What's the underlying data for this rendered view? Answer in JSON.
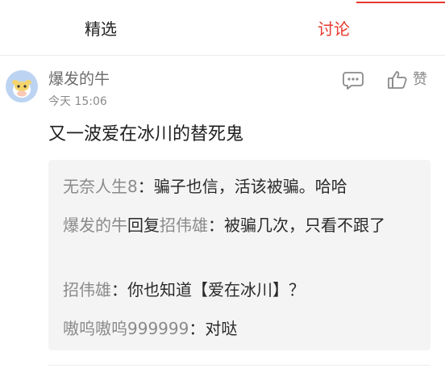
{
  "tabs": {
    "featured": "精选",
    "discussion": "讨论"
  },
  "comment": {
    "username": "爆发的牛",
    "time": "今天  15:06",
    "text": "又一波爱在冰川的替死鬼",
    "like_label": "赞"
  },
  "replies": [
    {
      "name": "无奈人生8",
      "sep": "：",
      "text": "骗子也信，活该被骗。哈哈"
    },
    {
      "name": "爆发的牛",
      "action": "回复",
      "target": "招伟雄",
      "sep": "：",
      "text": "被骗几次，只看不跟了"
    },
    {
      "name": "招伟雄",
      "sep": "：",
      "text": "你也知道【爱在冰川】？"
    },
    {
      "name": "嗷呜嗷呜999999",
      "sep": "：",
      "text": "对哒"
    }
  ],
  "colors": {
    "accent": "#e8392f",
    "muted": "#8a8a8a",
    "reply_bg": "#f4f4f4",
    "avatar_bg": "#bcd4f2"
  },
  "icons": {
    "reply": "comment-bubble-icon",
    "like": "thumbs-up-icon",
    "avatar": "cow-avatar-icon"
  }
}
